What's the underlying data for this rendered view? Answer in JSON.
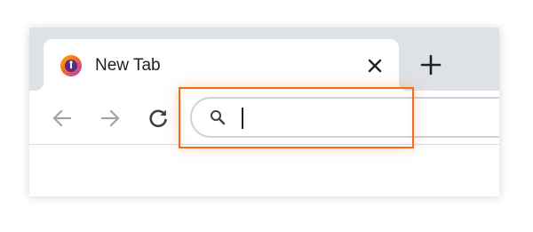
{
  "browser": {
    "tab": {
      "title": "New Tab",
      "favicon_icon": "browser-logo-icon",
      "close_icon": "close-icon"
    },
    "new_tab_icon": "plus-icon",
    "toolbar": {
      "back_icon": "arrow-left-icon",
      "forward_icon": "arrow-right-icon",
      "reload_icon": "reload-icon"
    },
    "omnibox": {
      "search_icon": "search-icon",
      "value": ""
    }
  },
  "annotation": {
    "highlight_color": "#f26c1b"
  },
  "colors": {
    "tab_strip": "#dee1e6",
    "tab": "#ffffff",
    "icon_inactive": "#a0a4a8",
    "icon_active": "#3c4043",
    "omnibox_border": "#d0d3d7"
  }
}
